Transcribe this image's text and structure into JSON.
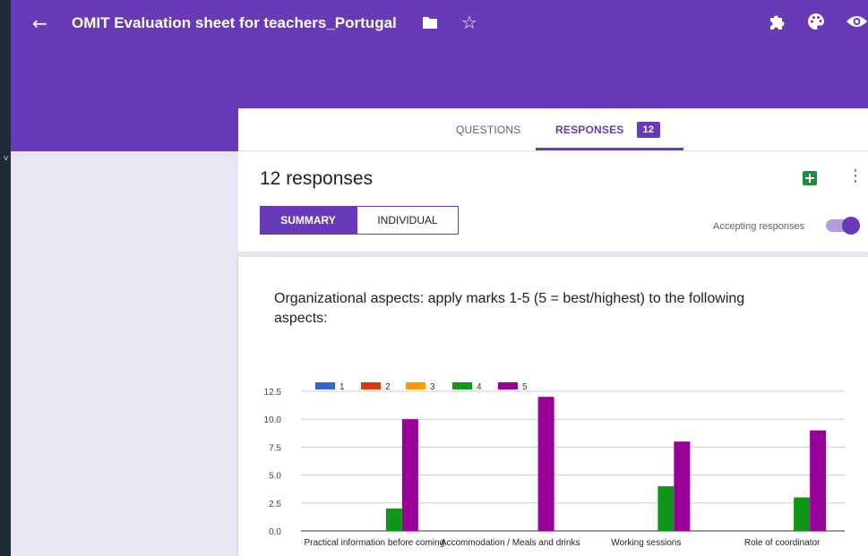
{
  "header": {
    "form_title": "OMIT Evaluation sheet for teachers_Portugal",
    "icons": [
      "back-arrow-icon",
      "folder-icon",
      "star-icon",
      "puzzle-icon",
      "palette-icon",
      "eye-icon"
    ],
    "color": "#673ab7"
  },
  "tabs": {
    "questions_label": "QUESTIONS",
    "responses_label": "RESPONSES",
    "responses_badge": "12"
  },
  "responses": {
    "count_text": "12 responses",
    "summary_label": "SUMMARY",
    "individual_label": "INDIVIDUAL",
    "accepting_label": "Accepting responses",
    "accepting": true
  },
  "question": {
    "title": "Organizational aspects: apply marks 1-5 (5 = best/highest) to the following aspects:"
  },
  "chart_data": {
    "type": "bar",
    "title": "",
    "categories": [
      "Practical information before coming",
      "Accommodation / Meals and drinks",
      "Working sessions",
      "Role of coordinator"
    ],
    "series": [
      {
        "name": "1",
        "color": "#3366cc",
        "values": [
          0,
          0,
          0,
          0
        ]
      },
      {
        "name": "2",
        "color": "#dc3912",
        "values": [
          0,
          0,
          0,
          0
        ]
      },
      {
        "name": "3",
        "color": "#ff9900",
        "values": [
          0,
          0,
          0,
          0
        ]
      },
      {
        "name": "4",
        "color": "#109618",
        "values": [
          2,
          0,
          4,
          3
        ]
      },
      {
        "name": "5",
        "color": "#990099",
        "values": [
          10,
          12,
          8,
          9
        ]
      }
    ],
    "yticks": [
      "0.0",
      "2.5",
      "5.0",
      "7.5",
      "10.0",
      "12.5"
    ],
    "ylim": [
      0,
      12.5
    ],
    "grid": true,
    "legend": "top-left"
  }
}
